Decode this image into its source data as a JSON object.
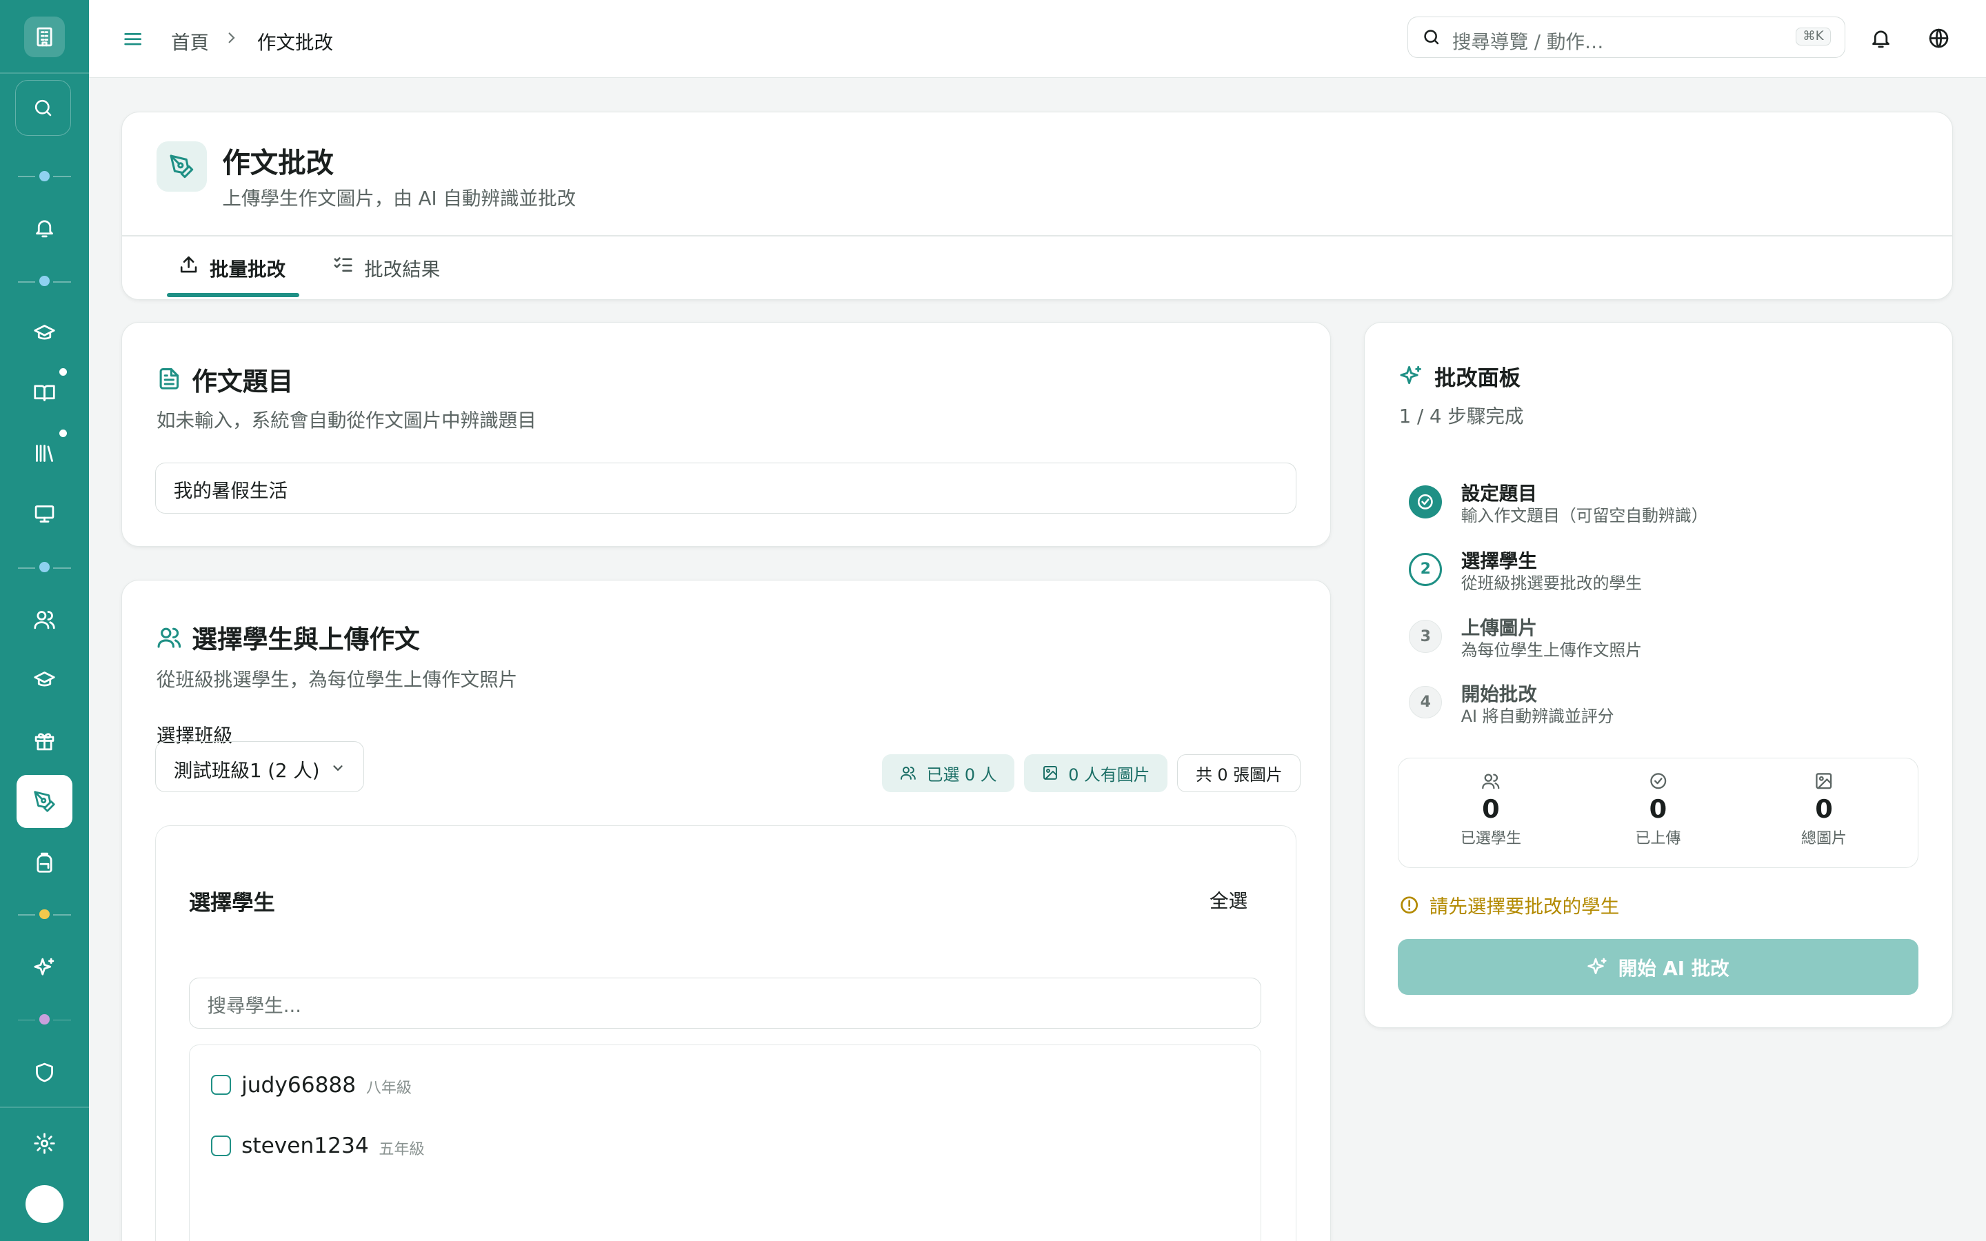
{
  "sidebar": {
    "icons": [
      "building-icon",
      "search-icon",
      "bell-icon",
      "graduation-cap-icon",
      "book-icon",
      "library-icon",
      "monitor-icon",
      "users-icon",
      "graduation-cap-icon",
      "gift-icon",
      "pen-tool-icon",
      "backpack-icon",
      "sparkles-icon",
      "shield-icon",
      "gear-icon"
    ],
    "separator_colors": [
      "#8fd1f0",
      "#8fd1f0",
      "#8fd1f0",
      "#f2c94c",
      "#c9a0dc"
    ]
  },
  "header": {
    "breadcrumb_home": "首頁",
    "breadcrumb_current": "作文批改",
    "search_placeholder": "搜尋導覽 / 動作…",
    "search_shortcut": "⌘K"
  },
  "page": {
    "title": "作文批改",
    "subtitle": "上傳學生作文圖片，由 AI 自動辨識並批改",
    "tabs": [
      {
        "label": "批量批改",
        "active": true
      },
      {
        "label": "批改結果",
        "active": false
      }
    ]
  },
  "topic": {
    "title": "作文題目",
    "subtitle": "如未輸入，系統會自動從作文圖片中辨識題目",
    "value": "我的暑假生活"
  },
  "students_section": {
    "title": "選擇學生與上傳作文",
    "subtitle": "從班級挑選學生，為每位學生上傳作文照片",
    "class_label": "選擇班級",
    "class_value": "測試班級1 (2 人)",
    "pill_selected": "已選 0 人",
    "pill_with_images": "0 人有圖片",
    "pill_total": "共 0 張圖片",
    "list_title": "選擇學生",
    "select_all": "全選",
    "search_placeholder": "搜尋學生...",
    "students": [
      {
        "name": "judy66888",
        "grade": "八年級"
      },
      {
        "name": "steven1234",
        "grade": "五年級"
      }
    ]
  },
  "panel": {
    "title": "批改面板",
    "progress": "1 / 4 步驟完成",
    "steps": [
      {
        "index": "1",
        "title": "設定題目",
        "desc": "輸入作文題目（可留空自動辨識）",
        "state": "done"
      },
      {
        "index": "2",
        "title": "選擇學生",
        "desc": "從班級挑選要批改的學生",
        "state": "current"
      },
      {
        "index": "3",
        "title": "上傳圖片",
        "desc": "為每位學生上傳作文照片",
        "state": "todo"
      },
      {
        "index": "4",
        "title": "開始批改",
        "desc": "AI 將自動辨識並評分",
        "state": "todo"
      }
    ],
    "stats": [
      {
        "value": "0",
        "label": "已選學生"
      },
      {
        "value": "0",
        "label": "已上傳"
      },
      {
        "value": "0",
        "label": "總圖片"
      }
    ],
    "warning": "請先選擇要批改的學生",
    "start_button": "開始 AI 批改"
  },
  "colors": {
    "brand": "#1f9085",
    "warning": "#b38a00",
    "disabled_button": "#8ccac3"
  }
}
